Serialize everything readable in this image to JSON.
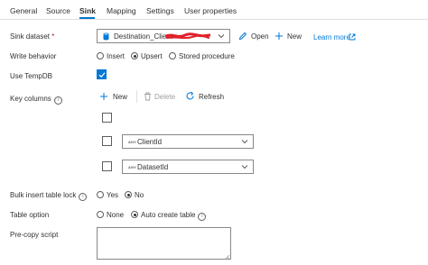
{
  "tabs": [
    {
      "label": "General"
    },
    {
      "label": "Source"
    },
    {
      "label": "Sink",
      "active": true
    },
    {
      "label": "Mapping"
    },
    {
      "label": "Settings"
    },
    {
      "label": "User properties"
    }
  ],
  "sink_dataset": {
    "label": "Sink dataset",
    "required_mark": "*",
    "value": "Destination_Client",
    "open_label": "Open",
    "new_label": "New",
    "learn_more_label": "Learn more"
  },
  "write_behavior": {
    "label": "Write behavior",
    "options": [
      "Insert",
      "Upsert",
      "Stored procedure"
    ],
    "selected": "Upsert"
  },
  "use_tempdb": {
    "label": "Use TempDB",
    "checked": true
  },
  "key_columns": {
    "label": "Key columns",
    "new_label": "New",
    "delete_label": "Delete",
    "refresh_label": "Refresh",
    "type_badge": "ANY",
    "rows": [
      {
        "value": "ClientId"
      },
      {
        "value": "DatasetId"
      }
    ]
  },
  "bulk_insert_table_lock": {
    "label": "Bulk insert table lock",
    "options": [
      "Yes",
      "No"
    ],
    "selected": "No"
  },
  "table_option": {
    "label": "Table option",
    "options": [
      "None",
      "Auto create table"
    ],
    "selected": "Auto create table"
  },
  "pre_copy_script": {
    "label": "Pre-copy script",
    "value": ""
  },
  "colors": {
    "accent": "#0078d4",
    "redaction": "#e0202a",
    "text": "#323130",
    "border": "#8a8886"
  },
  "icons": {
    "dataset": "database-icon",
    "open": "pencil-icon",
    "new": "plus-icon",
    "learn_more": "external-link-icon",
    "delete": "trash-icon",
    "refresh": "refresh-icon",
    "info": "info-icon",
    "dropdown": "chevron-down-icon"
  }
}
